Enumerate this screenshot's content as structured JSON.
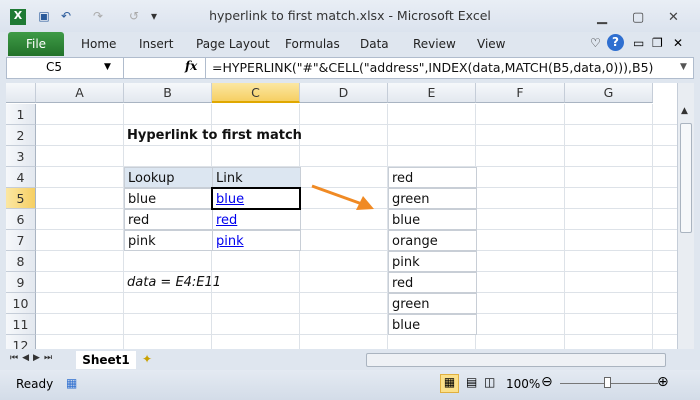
{
  "window": {
    "title": "hyperlink to first match.xlsx  -  Microsoft Excel"
  },
  "ribbon": {
    "tabs": [
      "File",
      "Home",
      "Insert",
      "Page Layout",
      "Formulas",
      "Data",
      "Review",
      "View"
    ]
  },
  "formula_bar": {
    "name_box": "C5",
    "fx": "fx",
    "formula": "=HYPERLINK(\"#\"&CELL(\"address\",INDEX(data,MATCH(B5,data,0))),B5)"
  },
  "columns": [
    "A",
    "B",
    "C",
    "D",
    "E",
    "F",
    "G"
  ],
  "rows": [
    "1",
    "2",
    "3",
    "4",
    "5",
    "6",
    "7",
    "8",
    "9",
    "10",
    "11",
    "12"
  ],
  "sheet": {
    "title": "Hyperlink to first match",
    "table_headers": [
      "Lookup",
      "Link"
    ],
    "table_rows": [
      [
        "blue",
        "blue"
      ],
      [
        "red",
        "red"
      ],
      [
        "pink",
        "pink"
      ]
    ],
    "note": "data = E4:E11",
    "data_list": [
      "red",
      "green",
      "blue",
      "orange",
      "pink",
      "red",
      "green",
      "blue"
    ],
    "arrow_color": "#f08a24"
  },
  "sheet_tabs": [
    "Sheet1"
  ],
  "status": {
    "ready": "Ready",
    "zoom": "100%"
  }
}
